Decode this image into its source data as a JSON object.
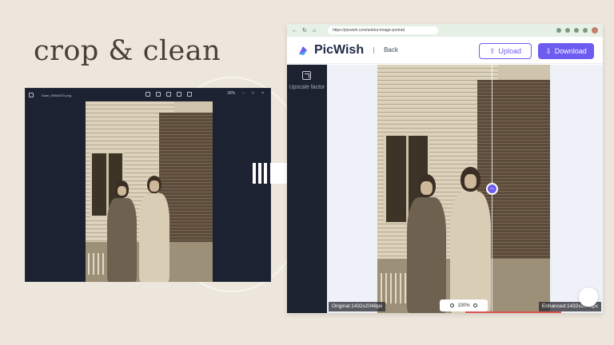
{
  "headline": "crop & clean",
  "viewer": {
    "filename": "Scan_00004670.png",
    "zoom": "28%"
  },
  "browser": {
    "url": "https://picwish.com/unblur-image-portrait"
  },
  "app": {
    "brand": "PicWish",
    "back_label": "Back",
    "upload_label": "Upload",
    "download_label": "Download",
    "sidebar_label": "Upscale factor",
    "original_label": "Original:1432x2048px",
    "enhanced_label": "Enhanced:1432x2048px",
    "zoom_level": "100%",
    "accent": "#6d5cf0"
  }
}
